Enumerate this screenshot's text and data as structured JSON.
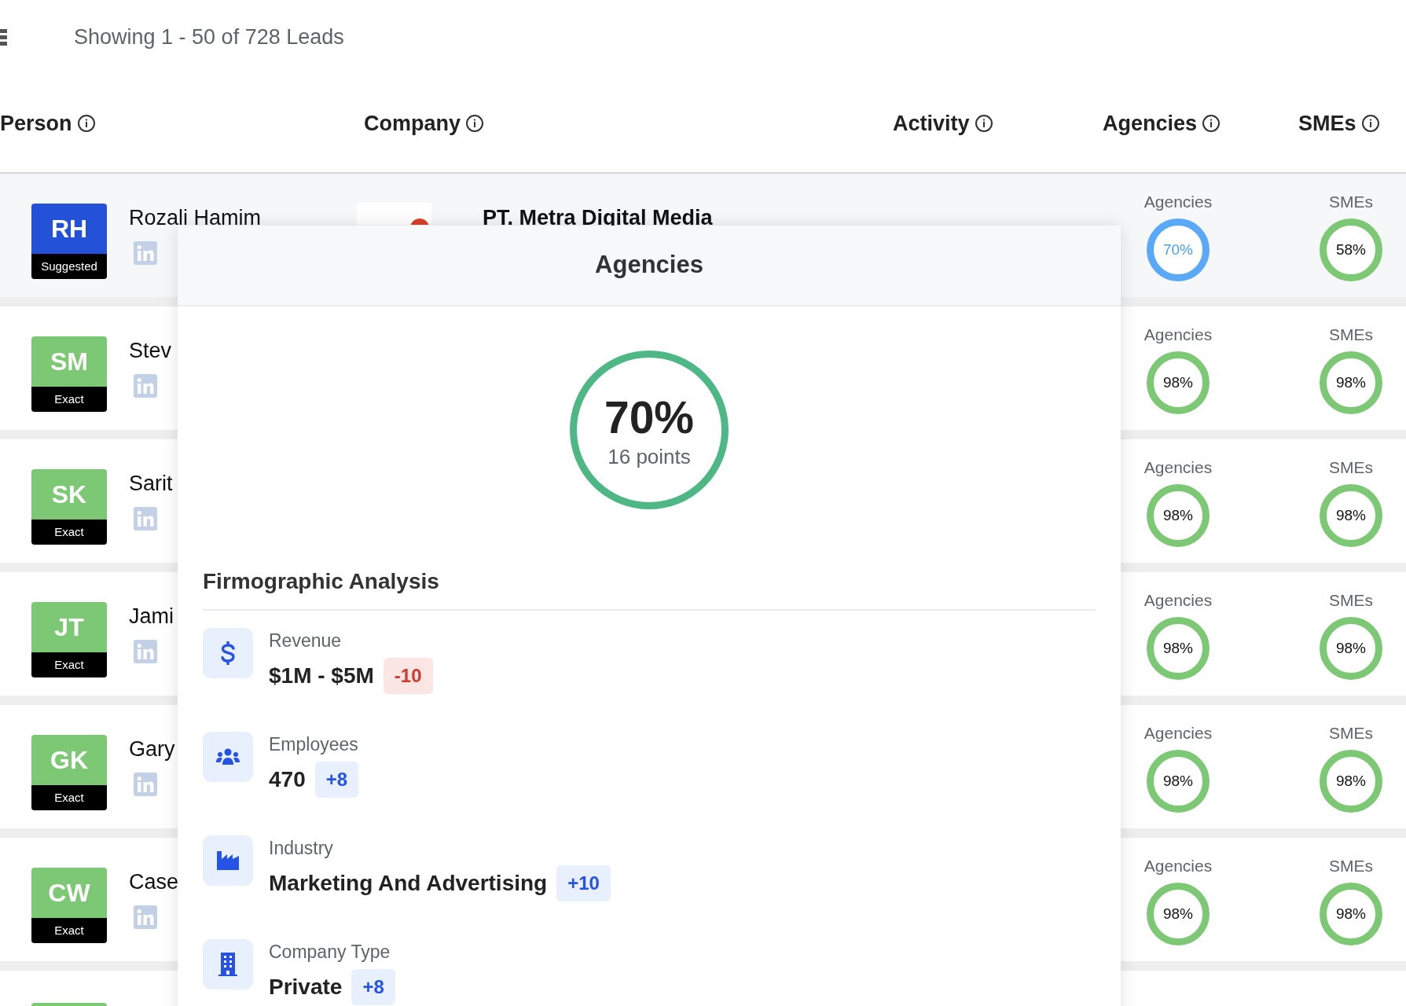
{
  "summary": "Showing 1 - 50 of 728 Leads",
  "columns": [
    "Person",
    "Company",
    "Activity",
    "Agencies",
    "SMEs"
  ],
  "rows": [
    {
      "initials": "RH",
      "match": "Suggested",
      "color": "#2352d8",
      "name": "Rozali Hamim",
      "company": "PT. Metra Digital Media",
      "agencies": {
        "label": "Agencies",
        "value": "70%",
        "selected": true
      },
      "smes": {
        "label": "SMEs",
        "value": "58%",
        "selected": false
      }
    },
    {
      "initials": "SM",
      "match": "Exact",
      "color": "#7dc874",
      "name": "Stev",
      "agencies": {
        "label": "Agencies",
        "value": "98%",
        "selected": false
      },
      "smes": {
        "label": "SMEs",
        "value": "98%",
        "selected": false
      }
    },
    {
      "initials": "SK",
      "match": "Exact",
      "color": "#7dc874",
      "name": "Sarit",
      "agencies": {
        "label": "Agencies",
        "value": "98%",
        "selected": false
      },
      "smes": {
        "label": "SMEs",
        "value": "98%",
        "selected": false
      }
    },
    {
      "initials": "JT",
      "match": "Exact",
      "color": "#7dc874",
      "name": "Jami",
      "agencies": {
        "label": "Agencies",
        "value": "98%",
        "selected": false
      },
      "smes": {
        "label": "SMEs",
        "value": "98%",
        "selected": false
      }
    },
    {
      "initials": "GK",
      "match": "Exact",
      "color": "#7dc874",
      "name": "Gary",
      "agencies": {
        "label": "Agencies",
        "value": "98%",
        "selected": false
      },
      "smes": {
        "label": "SMEs",
        "value": "98%",
        "selected": false
      }
    },
    {
      "initials": "CW",
      "match": "Exact",
      "color": "#7dc874",
      "name": "Case",
      "agencies": {
        "label": "Agencies",
        "value": "98%",
        "selected": false
      },
      "smes": {
        "label": "SMEs",
        "value": "98%",
        "selected": false
      }
    }
  ],
  "popover": {
    "title": "Agencies",
    "score": "70%",
    "points": "16 points",
    "section": "Firmographic Analysis",
    "items": [
      {
        "kind": "revenue",
        "label": "Revenue",
        "value": "$1M - $5M",
        "delta": "-10",
        "negative": true
      },
      {
        "kind": "employees",
        "label": "Employees",
        "value": "470",
        "delta": "+8",
        "negative": false
      },
      {
        "kind": "industry",
        "label": "Industry",
        "value": "Marketing And Advertising",
        "delta": "+10",
        "negative": false
      },
      {
        "kind": "company_type",
        "label": "Company Type",
        "value": "Private",
        "delta": "+8",
        "negative": false
      }
    ]
  }
}
